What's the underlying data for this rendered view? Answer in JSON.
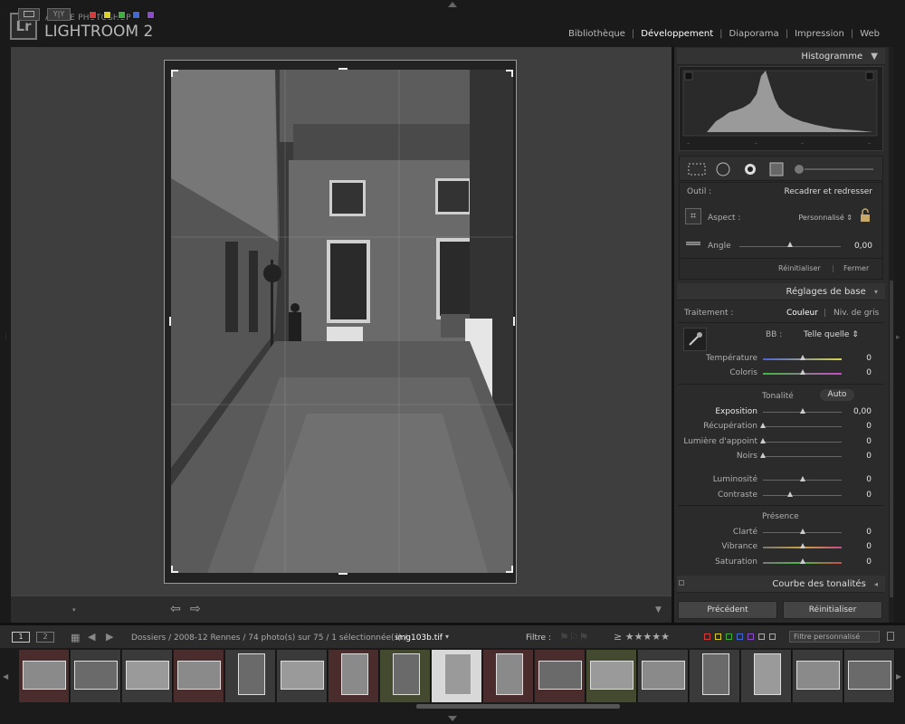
{
  "app": {
    "name_small": "ADOBE PHOTOSHOP",
    "name_big": "LIGHTROOM 2",
    "logo": "Lr"
  },
  "modules": [
    {
      "label": "Bibliothèque",
      "active": false
    },
    {
      "label": "Développement",
      "active": true
    },
    {
      "label": "Diaporama",
      "active": false
    },
    {
      "label": "Impression",
      "active": false
    },
    {
      "label": "Web",
      "active": false
    }
  ],
  "histogram": {
    "title": "Histogramme"
  },
  "crop": {
    "tool_label": "Outil :",
    "tool_value": "Recadrer et redresser",
    "aspect_label": "Aspect :",
    "aspect_value": "Personnalisé ⇕",
    "angle_label": "Angle",
    "angle_value": "0,00",
    "angle_level": 0.5,
    "reset": "Réinitialiser",
    "close": "Fermer"
  },
  "basic": {
    "title": "Réglages de base",
    "traitement_label": "Traitement :",
    "couleur": "Couleur",
    "niv_gris": "Niv. de gris",
    "bb_label": "BB :",
    "bb_value": "Telle quelle ⇕",
    "tonalite": "Tonalité",
    "auto": "Auto",
    "presence": "Présence",
    "sliders": [
      {
        "label": "Température",
        "value": "0",
        "level": 0.5
      },
      {
        "label": "Coloris",
        "value": "0",
        "level": 0.5
      },
      {
        "label": "Exposition",
        "value": "0,00",
        "level": 0.5
      },
      {
        "label": "Récupération",
        "value": "0",
        "level": 0.0
      },
      {
        "label": "Lumière d'appoint",
        "value": "0",
        "level": 0.0
      },
      {
        "label": "Noirs",
        "value": "0",
        "level": 0.0
      },
      {
        "label": "Luminosité",
        "value": "0",
        "level": 0.5
      },
      {
        "label": "Contraste",
        "value": "0",
        "level": 0.35
      },
      {
        "label": "Clarté",
        "value": "0",
        "level": 0.5
      },
      {
        "label": "Vibrance",
        "value": "0",
        "level": 0.5
      },
      {
        "label": "Saturation",
        "value": "0",
        "level": 0.5
      }
    ]
  },
  "tone_curve": {
    "title": "Courbe des tonalités"
  },
  "bottom_buttons": {
    "previous": "Précédent",
    "reset": "Réinitialiser"
  },
  "filmstrip": {
    "page1": "1",
    "page2": "2",
    "path": "Dossiers / 2008-12 Rennes / 74 photo(s) sur 75 / 1 sélectionnée(s) /",
    "filename": "img103b.tif",
    "filter_label": "Filtre :",
    "filter_preset": "Filtre personnalisé",
    "stars": "≥ ★★★★★"
  },
  "label_colors": [
    "#d43c3c",
    "#d9cf2a",
    "#3fae3f",
    "#4169d6",
    "#8a4bc8"
  ]
}
